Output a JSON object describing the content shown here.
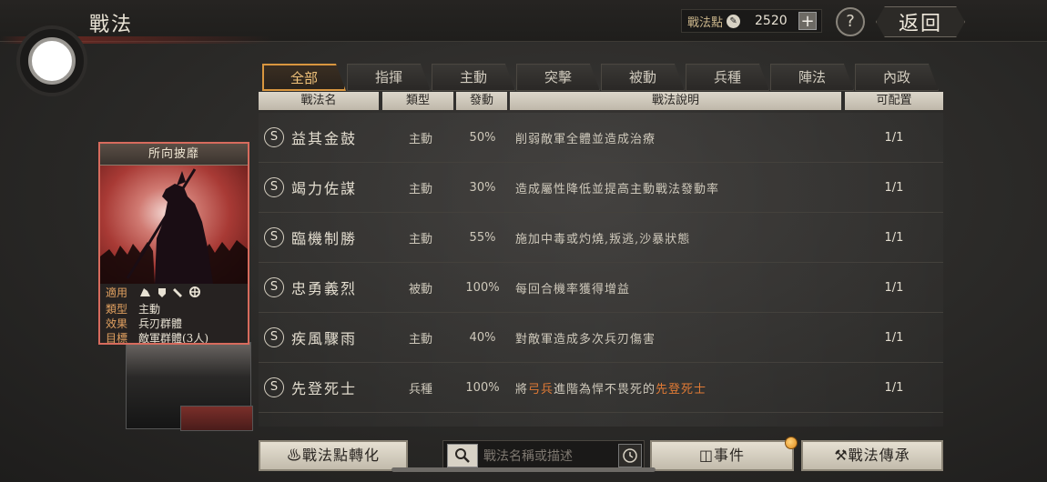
{
  "header": {
    "title": "戰法",
    "points_label": "戰法點",
    "points_value": "2520",
    "plus": "+",
    "help": "?",
    "back": "返回"
  },
  "tabs": [
    {
      "label": "全部",
      "active": true
    },
    {
      "label": "指揮",
      "active": false
    },
    {
      "label": "主動",
      "active": false
    },
    {
      "label": "突擊",
      "active": false
    },
    {
      "label": "被動",
      "active": false
    },
    {
      "label": "兵種",
      "active": false
    },
    {
      "label": "陣法",
      "active": false
    },
    {
      "label": "內政",
      "active": false
    }
  ],
  "columns": {
    "name": "戰法名",
    "type": "類型",
    "rate": "發動",
    "desc": "戰法說明",
    "count": "可配置"
  },
  "rows": [
    {
      "grade": "S",
      "name": "益其金鼓",
      "type": "主動",
      "rate": "50%",
      "desc": "削弱敵軍全體並造成治療",
      "count": "1/1"
    },
    {
      "grade": "S",
      "name": "竭力佐謀",
      "type": "主動",
      "rate": "30%",
      "desc": "造成屬性降低並提高主動戰法發動率",
      "count": "1/1"
    },
    {
      "grade": "S",
      "name": "臨機制勝",
      "type": "主動",
      "rate": "55%",
      "desc": "施加中毒或灼燒,叛逃,沙暴狀態",
      "count": "1/1"
    },
    {
      "grade": "S",
      "name": "忠勇義烈",
      "type": "被動",
      "rate": "100%",
      "desc": "每回合機率獲得增益",
      "count": "1/1"
    },
    {
      "grade": "S",
      "name": "疾風驟雨",
      "type": "主動",
      "rate": "40%",
      "desc": "對敵軍造成多次兵刃傷害",
      "count": "1/1"
    },
    {
      "grade": "S",
      "name": "先登死士",
      "type": "兵種",
      "rate": "100%",
      "desc_parts": [
        "將",
        "弓兵",
        "進階為悍不畏死的",
        "先登死士"
      ],
      "count": "1/1"
    }
  ],
  "card": {
    "title": "所向披靡",
    "labels": [
      "適用",
      "類型",
      "效果",
      "目標"
    ],
    "type": "主動",
    "effect": "兵刃群體",
    "target": "敵軍群體(3人)"
  },
  "bottom": {
    "convert": "戰法點轉化",
    "search_placeholder": "戰法名稱或描述",
    "events": "事件",
    "inherit": "戰法傳承"
  },
  "colors": {
    "accent": "#d9963f",
    "highlight": "#e07a35",
    "card_border": "#d76b5d"
  }
}
